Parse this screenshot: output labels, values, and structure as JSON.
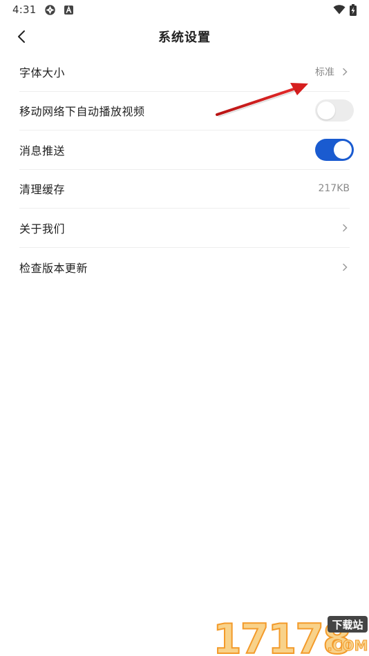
{
  "status_bar": {
    "time": "4:31",
    "icons": [
      "aperture-icon",
      "font-a-icon",
      "wifi-icon",
      "battery-charging-icon"
    ]
  },
  "header": {
    "title": "系统设置",
    "back_icon": "chevron-left-icon"
  },
  "settings": [
    {
      "label": "字体大小",
      "value": "标准",
      "control": "chevron"
    },
    {
      "label": "移动网络下自动播放视频",
      "control": "toggle",
      "state": "off"
    },
    {
      "label": "消息推送",
      "control": "toggle",
      "state": "on"
    },
    {
      "label": "清理缓存",
      "value": "217KB",
      "control": "none"
    },
    {
      "label": "关于我们",
      "control": "chevron"
    },
    {
      "label": "检查版本更新",
      "control": "chevron"
    }
  ],
  "colors": {
    "toggle_on": "#1a5bd0",
    "toggle_off": "#ececec",
    "annotation_arrow": "#d61e1e",
    "watermark_orange": "#f39a2a"
  },
  "watermark": {
    "digits": "17178",
    "badge": "下载站",
    "domain": ".COM"
  }
}
